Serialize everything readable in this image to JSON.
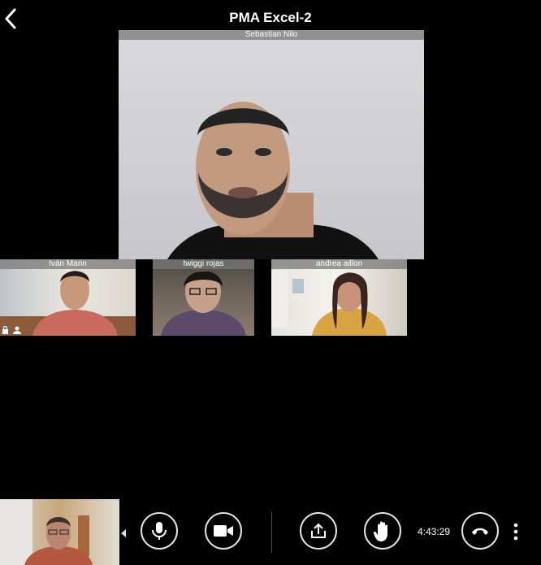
{
  "header": {
    "title": "PMA Excel-2"
  },
  "participants": {
    "main": {
      "name": "Sebastian Nilo"
    },
    "thumbs": [
      {
        "name": "Iván Marin"
      },
      {
        "name": "twiggi rojas"
      },
      {
        "name": "andrea aillon"
      }
    ]
  },
  "controls": {
    "timer": "4:43:29",
    "end_call_color": "#ffffff"
  },
  "icons": {
    "back": "chevron-left-icon",
    "mic": "microphone-icon",
    "camera": "video-camera-icon",
    "share": "share-screen-icon",
    "hand": "raise-hand-icon",
    "hangup": "phone-hangup-icon",
    "more": "more-vertical-icon"
  }
}
